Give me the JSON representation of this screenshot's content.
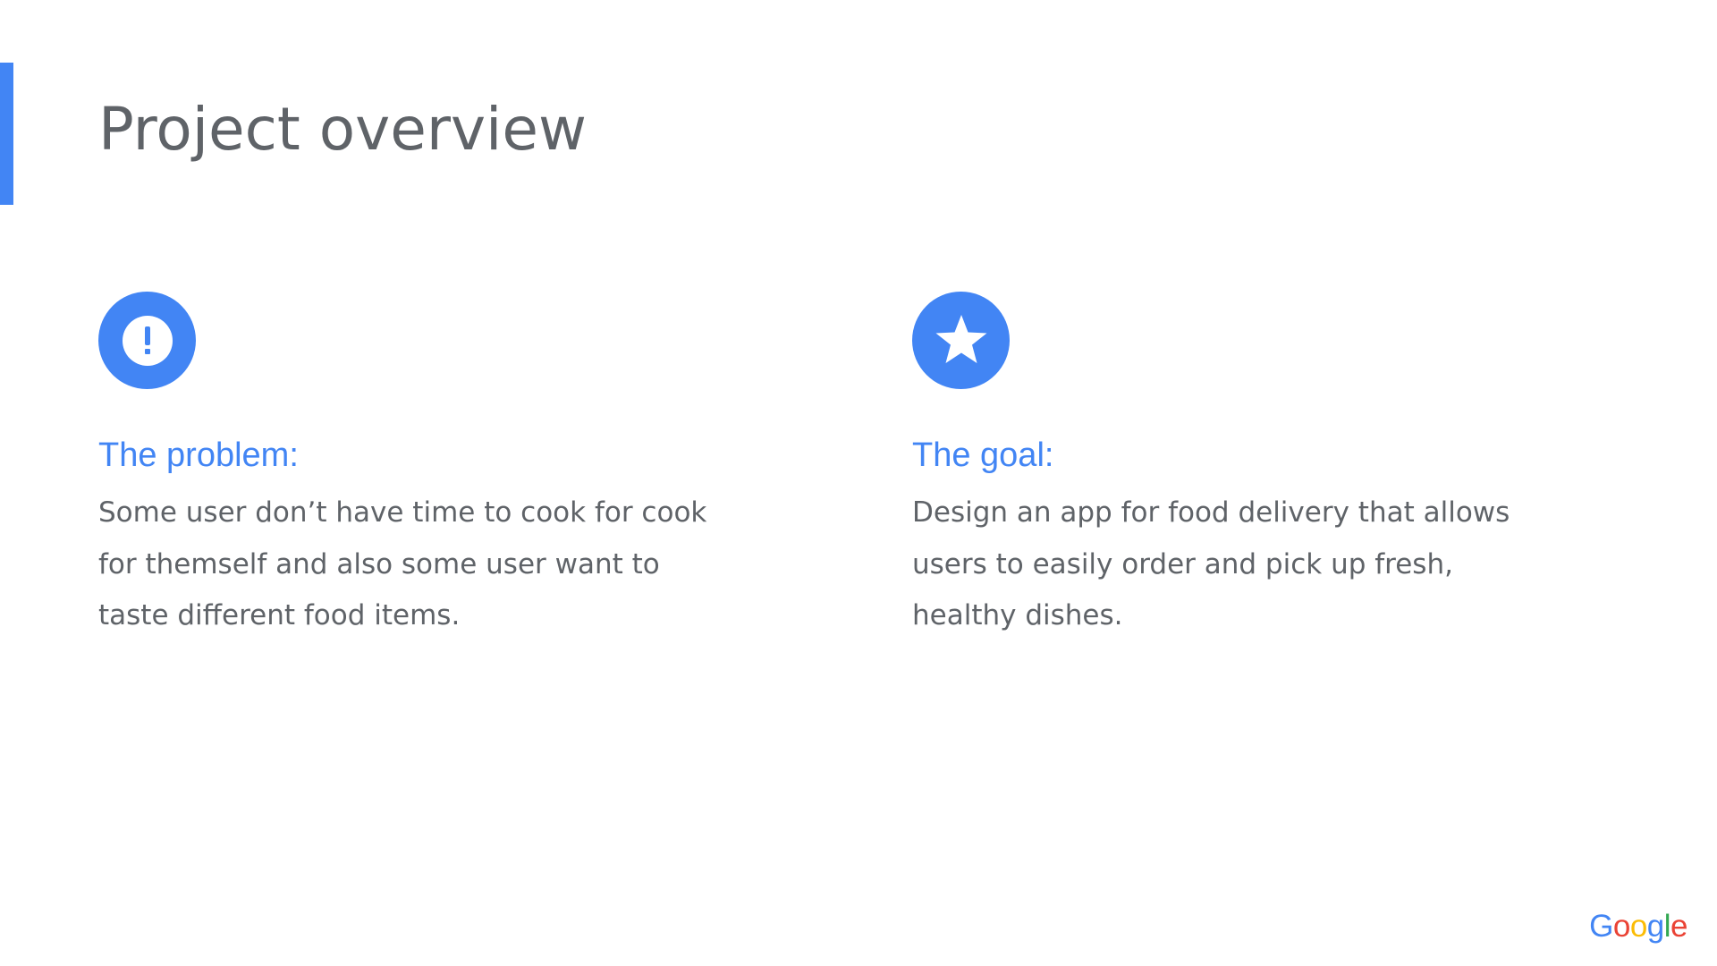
{
  "slide": {
    "title": "Project overview"
  },
  "problem": {
    "icon": "exclamation-circle-icon",
    "heading": "The problem:",
    "body": "Some user don’t have time to cook for cook for themself and also some user want to taste different food items."
  },
  "goal": {
    "icon": "star-circle-icon",
    "heading": "The goal:",
    "body": "Design an app for food delivery that allows users to easily order and pick up fresh, healthy dishes."
  },
  "logo": {
    "text": "Google",
    "letters": [
      "G",
      "o",
      "o",
      "g",
      "l",
      "e"
    ],
    "letter_colors": [
      "#4285f4",
      "#ea4335",
      "#fbbc05",
      "#4285f4",
      "#34a853",
      "#ea4335"
    ]
  },
  "colors": {
    "accent": "#4285f4",
    "text": "#5f6368",
    "background": "#ffffff"
  }
}
